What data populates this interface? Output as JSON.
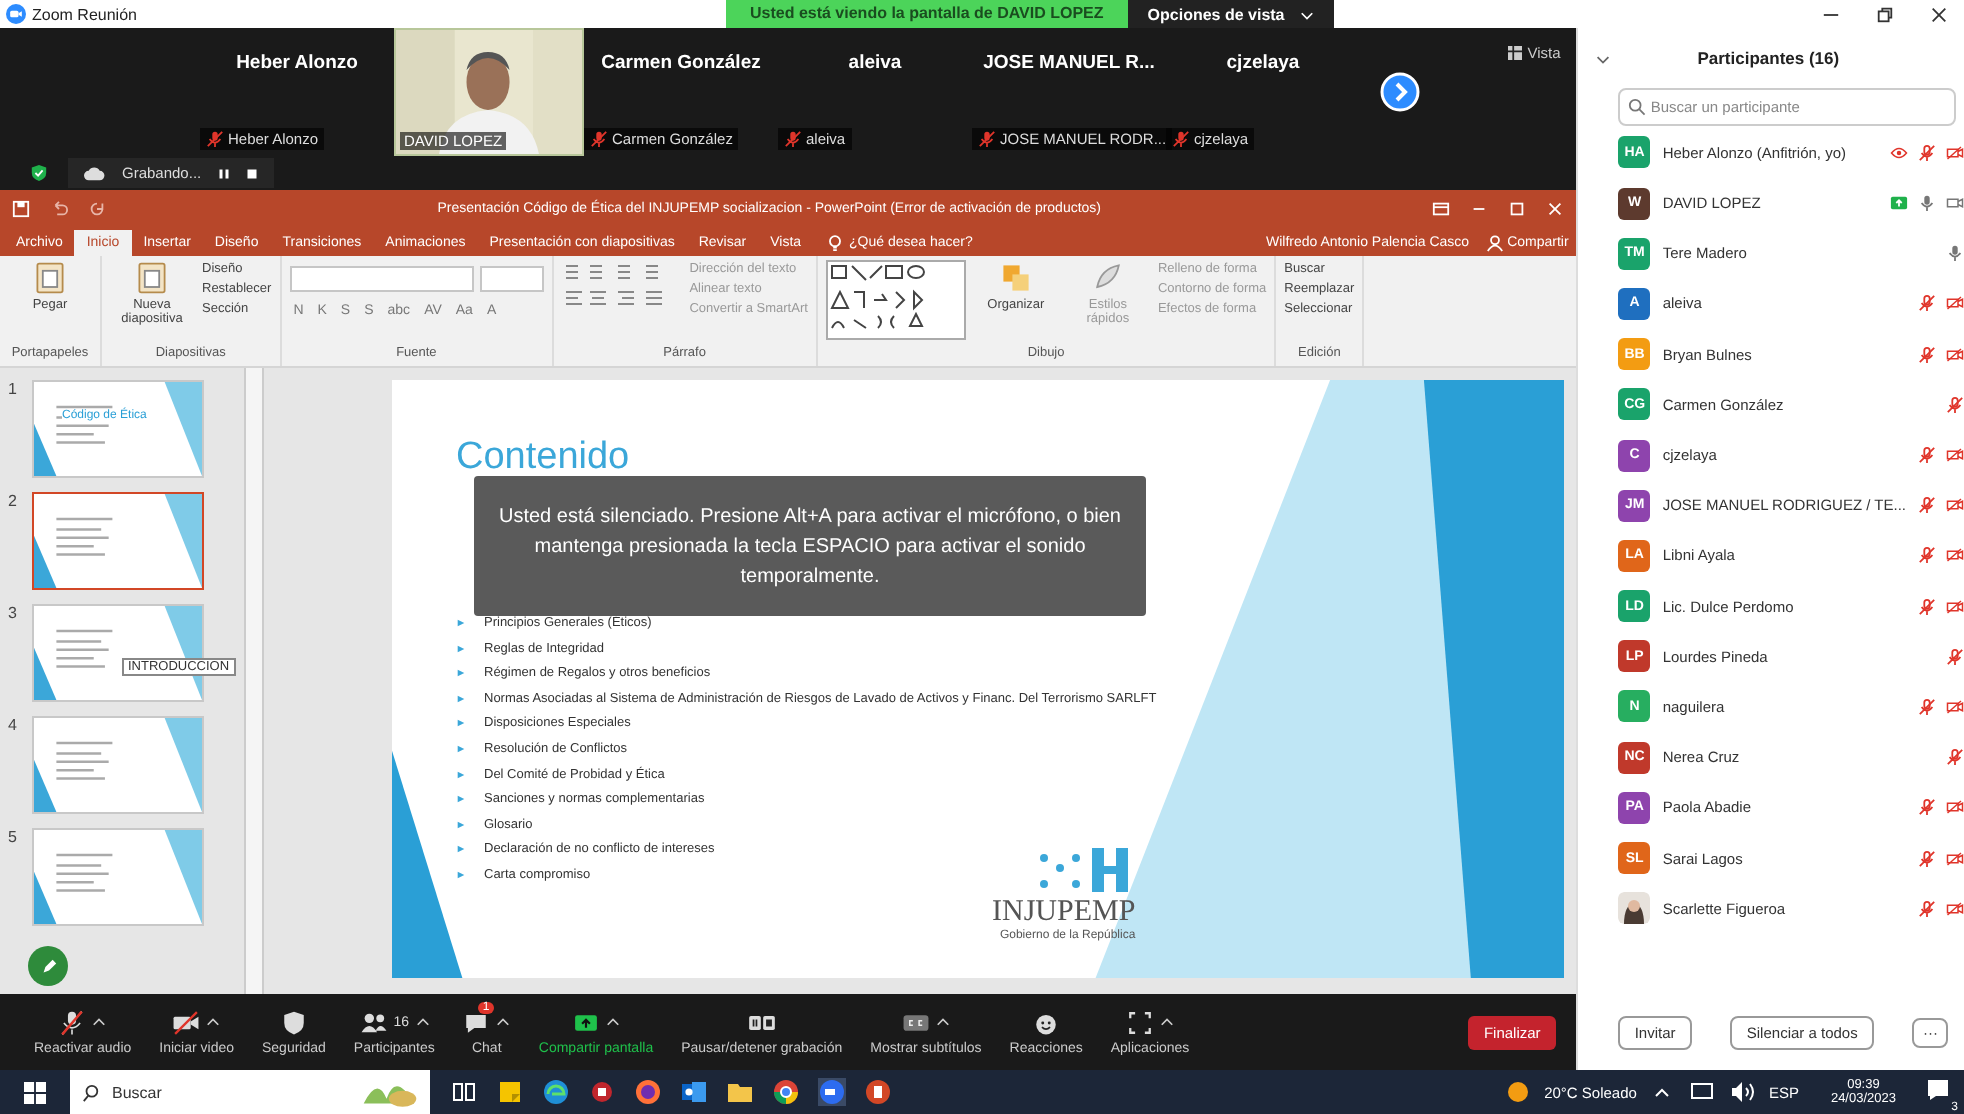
{
  "window": {
    "title": "Zoom Reunión"
  },
  "share_banner": {
    "text": "Usted está viendo la pantalla de DAVID LOPEZ",
    "options": "Opciones de vista"
  },
  "video_strip": {
    "tiles": [
      {
        "kind": "name",
        "name": "Heber Alonzo",
        "label": "Heber Alonzo"
      },
      {
        "kind": "video",
        "label": "DAVID LOPEZ"
      },
      {
        "kind": "name",
        "name": "Carmen González",
        "label": "Carmen González"
      },
      {
        "kind": "name",
        "name": "aleiva",
        "label": "aleiva"
      },
      {
        "kind": "name",
        "name": "JOSE MANUEL R...",
        "label": "JOSE MANUEL RODR..."
      },
      {
        "kind": "name",
        "name": "cjzelaya",
        "label": "cjzelaya"
      }
    ],
    "view": "Vista"
  },
  "recording": {
    "text": "Grabando..."
  },
  "powerpoint": {
    "title": "Presentación Código de Ética del INJUPEMP socializacion - PowerPoint (Error de activación de productos)",
    "tabs": [
      {
        "label": "Archivo",
        "selected": false
      },
      {
        "label": "Inicio",
        "selected": true
      },
      {
        "label": "Insertar",
        "selected": false
      },
      {
        "label": "Diseño",
        "selected": false
      },
      {
        "label": "Transiciones",
        "selected": false
      },
      {
        "label": "Animaciones",
        "selected": false
      },
      {
        "label": "Presentación con diapositivas",
        "selected": false
      },
      {
        "label": "Revisar",
        "selected": false
      },
      {
        "label": "Vista",
        "selected": false
      }
    ],
    "tell_me": "¿Qué desea hacer?",
    "user": "Wilfredo Antonio Palencia Casco",
    "share": "Compartir",
    "ribbon": [
      {
        "label": "Portapapeles",
        "big": "Pegar"
      },
      {
        "label": "Diapositivas",
        "big": "Nueva diapositiva",
        "items": [
          "Diseño",
          "Restablecer",
          "Sección"
        ]
      },
      {
        "label": "Fuente",
        "kind": "font",
        "items": [
          "N",
          "K",
          "S",
          "S",
          "abc",
          "AV",
          "Aa",
          "A"
        ]
      },
      {
        "label": "Párrafo",
        "kind": "paragraph",
        "items": [
          "Dirección del texto",
          "Alinear texto",
          "Convertir a SmartArt"
        ]
      },
      {
        "label": "Dibujo",
        "kind": "drawing",
        "big": "Organizar",
        "big2": "Estilos rápidos",
        "items": [
          "Relleno de forma",
          "Contorno de forma",
          "Efectos de forma"
        ]
      },
      {
        "label": "Edición",
        "items": [
          "Buscar",
          "Reemplazar",
          "Seleccionar"
        ]
      }
    ],
    "thumbnails": [
      {
        "number": "1",
        "selected": false,
        "title": "Código de Ética"
      },
      {
        "number": "2",
        "selected": true
      },
      {
        "number": "3",
        "selected": false,
        "tooltip": "INTRODUCCION"
      },
      {
        "number": "4",
        "selected": false
      },
      {
        "number": "5",
        "selected": false
      }
    ],
    "slide": {
      "title": "Contenido",
      "items": [
        "Principios Generales (Éticos)",
        "Reglas de Integridad",
        "Régimen de Regalos y otros beneficios",
        "Normas Asociadas al Sistema de Administración de Riesgos de Lavado de Activos y Financ. Del Terrorismo SARLFT",
        "Disposiciones Especiales",
        "Resolución de Conflictos",
        "Del Comité de Probidad y Ética",
        "Sanciones y normas complementarias",
        "Glosario",
        "Declaración de no conflicto de intereses",
        "Carta compromiso"
      ],
      "logo": "INJUPEMP",
      "logo_sub": "Gobierno de la República"
    }
  },
  "muted_notice": "Usted está silenciado. Presione Alt+A para activar el micrófono, o bien mantenga presionada la tecla ESPACIO para activar el sonido temporalmente.",
  "toolbar": [
    {
      "kind": "mic-muted",
      "label": "Reactivar audio",
      "caret": true
    },
    {
      "kind": "video-off",
      "label": "Iniciar video",
      "caret": true
    },
    {
      "kind": "shield",
      "label": "Seguridad"
    },
    {
      "kind": "people",
      "label": "Participantes",
      "count": "16",
      "caret": true
    },
    {
      "kind": "chat",
      "label": "Chat",
      "badge": "1",
      "caret": true
    },
    {
      "kind": "share",
      "label": "Compartir pantalla",
      "caret": true
    },
    {
      "kind": "pause",
      "label": "Pausar/detener grabación"
    },
    {
      "kind": "cc",
      "label": "Mostrar subtítulos",
      "caret": true
    },
    {
      "kind": "smile",
      "label": "Reacciones"
    },
    {
      "kind": "apps",
      "label": "Aplicaciones",
      "caret": true
    }
  ],
  "end_button": "Finalizar",
  "participants": {
    "title": "Participantes (16)",
    "search": {
      "placeholder": "Buscar un participante"
    },
    "list": [
      {
        "initials": "HA",
        "color": "#1aa36b",
        "name": "Heber Alonzo (Anfitrión, yo)",
        "icons": [
          {
            "kind": "record"
          },
          {
            "kind": "mic-muted"
          },
          {
            "kind": "video-off"
          }
        ]
      },
      {
        "initials": "W",
        "color": "#5d3a2e",
        "name": "DAVID LOPEZ",
        "icons": [
          {
            "kind": "share"
          },
          {
            "kind": "mic"
          },
          {
            "kind": "video"
          }
        ]
      },
      {
        "initials": "TM",
        "color": "#1aa36b",
        "name": "Tere Madero",
        "icons": [
          {
            "kind": "mic"
          }
        ]
      },
      {
        "initials": "A",
        "color": "#1f6fbf",
        "name": "aleiva",
        "icons": [
          {
            "kind": "mic-muted"
          },
          {
            "kind": "video-off"
          }
        ]
      },
      {
        "initials": "BB",
        "color": "#f39c12",
        "name": "Bryan Bulnes",
        "icons": [
          {
            "kind": "mic-muted"
          },
          {
            "kind": "video-off"
          }
        ]
      },
      {
        "initials": "CG",
        "color": "#1aa36b",
        "name": "Carmen González",
        "icons": [
          {
            "kind": "mic-muted"
          }
        ]
      },
      {
        "initials": "C",
        "color": "#8e44ad",
        "name": "cjzelaya",
        "icons": [
          {
            "kind": "mic-muted"
          },
          {
            "kind": "video-off"
          }
        ]
      },
      {
        "initials": "JM",
        "color": "#8e44ad",
        "name": "JOSE MANUEL RODRIGUEZ / TE...",
        "icons": [
          {
            "kind": "mic-muted"
          },
          {
            "kind": "video-off"
          }
        ]
      },
      {
        "initials": "LA",
        "color": "#e0661a",
        "name": "Libni Ayala",
        "icons": [
          {
            "kind": "mic-muted"
          },
          {
            "kind": "video-off"
          }
        ]
      },
      {
        "initials": "LD",
        "color": "#1aa36b",
        "name": "Lic. Dulce Perdomo",
        "icons": [
          {
            "kind": "mic-muted"
          },
          {
            "kind": "video-off"
          }
        ]
      },
      {
        "initials": "LP",
        "color": "#c0392b",
        "name": "Lourdes Pineda",
        "icons": [
          {
            "kind": "mic-muted"
          }
        ]
      },
      {
        "initials": "N",
        "color": "#27ae60",
        "name": "naguilera",
        "icons": [
          {
            "kind": "mic-muted"
          },
          {
            "kind": "video-off"
          }
        ]
      },
      {
        "initials": "NC",
        "color": "#c0392b",
        "name": "Nerea Cruz",
        "icons": [
          {
            "kind": "mic-muted"
          }
        ]
      },
      {
        "initials": "PA",
        "color": "#8e44ad",
        "name": "Paola Abadie",
        "icons": [
          {
            "kind": "mic-muted"
          },
          {
            "kind": "video-off"
          }
        ]
      },
      {
        "initials": "SL",
        "color": "#e0661a",
        "name": "Sarai Lagos",
        "icons": [
          {
            "kind": "mic-muted"
          },
          {
            "kind": "video-off"
          }
        ]
      },
      {
        "name": "Scarlette Figueroa",
        "icons": [
          {
            "kind": "mic-muted"
          },
          {
            "kind": "video-off"
          }
        ]
      }
    ],
    "buttons": [
      "Invitar",
      "Silenciar a todos",
      "···"
    ]
  },
  "taskbar": {
    "search": "Buscar",
    "weather": "20°C Soleado",
    "language": "ESP",
    "time": "09:39",
    "date": "24/03/2023",
    "notifications": "3"
  }
}
